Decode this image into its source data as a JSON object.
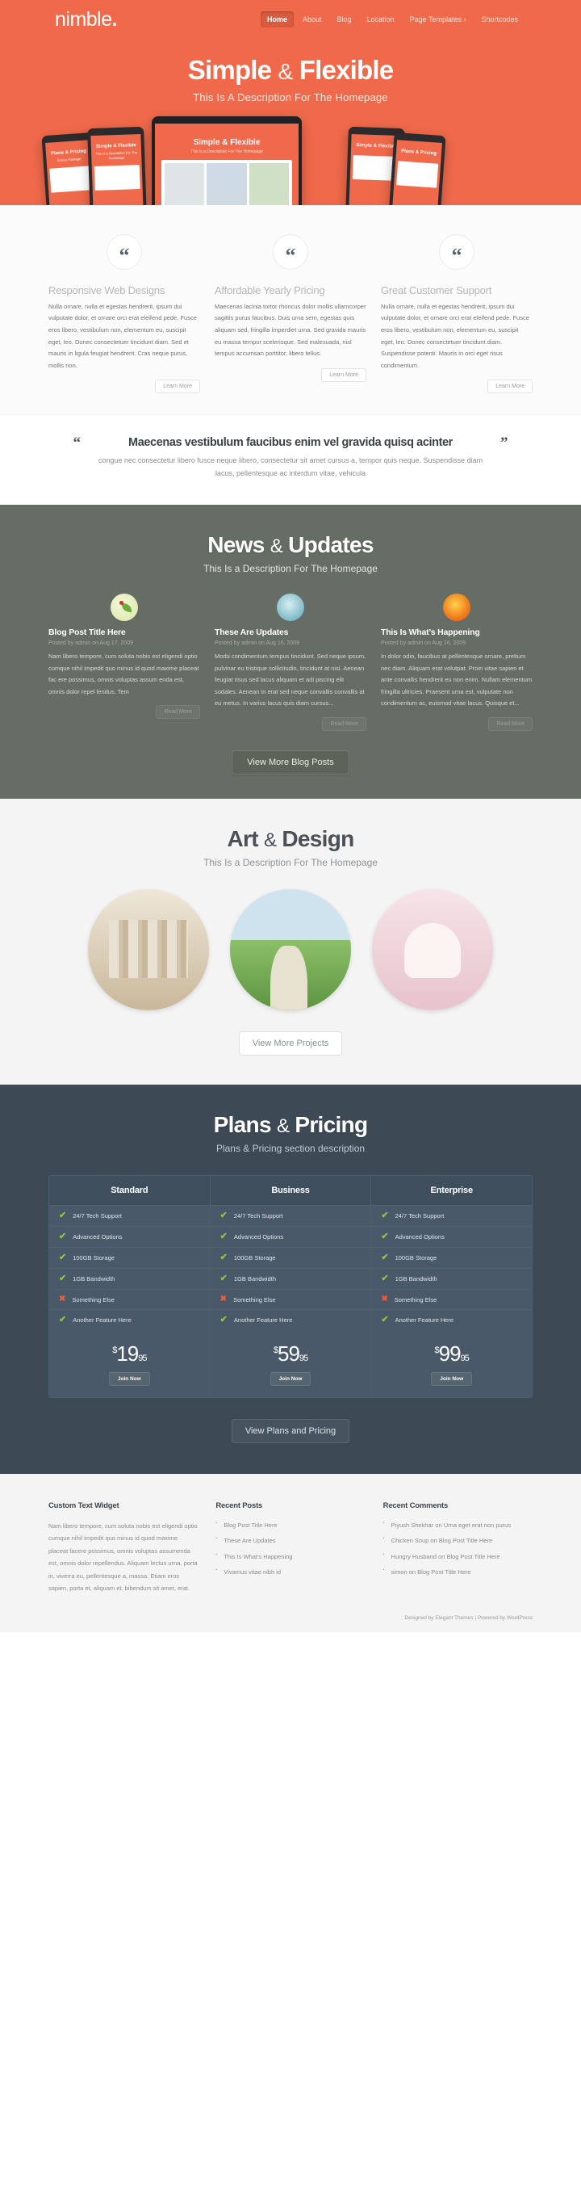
{
  "header": {
    "logo": "nimble",
    "logo_dot": ".",
    "nav": [
      {
        "label": "Home",
        "active": true
      },
      {
        "label": "About",
        "active": false
      },
      {
        "label": "Blog",
        "active": false
      },
      {
        "label": "Location",
        "active": false
      },
      {
        "label": "Page Templates ›",
        "active": false
      },
      {
        "label": "Shortcodes",
        "active": false
      }
    ]
  },
  "hero": {
    "title_main": "Simple",
    "title_amp": "&",
    "title_second": "Flexible",
    "subtitle": "This Is A Description For The Homepage",
    "device_title": "Simple & Flexible",
    "device_sub": "This Is a Description For The Homepage",
    "phone_title": "Plans & Pricing",
    "phone_sub": "Bronze Package"
  },
  "features": {
    "icon": "quote-icon",
    "button_label": "Learn More",
    "items": [
      {
        "title": "Responsive Web Designs",
        "body": "Nulla ornare, nulla et egestas hendrerit, ipsum dui vulputate dolor, et ornare orci erat eleifend pede. Fusce eros libero, vestibulum non, elementum eu, suscipit eget, leo. Donec consectetuer tincidunt diam. Sed et mauris in ligula feugiat hendrerit. Cras neque purus, mollis non."
      },
      {
        "title": "Affordable Yearly Pricing",
        "body": "Maecenas lacinia tortor rhoncus dolor mollis ullamcorper sagittis purus faucibus. Duis urna sem, egestas quis aliquam sed, fringilla imperdiet urna. Sed gravida mauris eu massa tempor scelerisque. Sed malesuada, nisl tempus accumsan porttitor, libero tellus."
      },
      {
        "title": "Great Customer Support",
        "body": "Nulla ornare, nulla et egestas hendrerit, ipsum dui vulputate dolor, et ornare orci erat eleifend pede. Fusce eros libero, vestibulum non, elementum eu, suscipit eget, leo. Donec consectetuer tincidunt diam. Suspendisse potenti. Mauris in orci eget risus condimentum."
      }
    ]
  },
  "quote": {
    "open_mark": "“",
    "close_mark": "”",
    "headline": "Maecenas vestibulum faucibus enim vel gravida quisq acinter",
    "body": "congue nec consectetur libero fusce neque libero, consectetur sit amet cursus a, tempor quis neque. Suspendisse diam lacus, pellentesque ac interdum vitae, vehicula"
  },
  "news": {
    "title_main": "News",
    "title_amp": "&",
    "title_second": "Updates",
    "subtitle": "This Is a Description For The Homepage",
    "read_more": "Read More",
    "cta": "View More Blog Posts",
    "posts": [
      {
        "icon": "leaf-ladybug-icon",
        "title": "Blog Post Title Here",
        "meta": "Posted by admin on Aug 17, 2009",
        "body": "Nam libero tempore, cum soluta nobis est eligendi optio cumque nihil impedit quo minus id quod maxime placeat fac ere possimus, omnis voluptas assum enda est, omnis dolor repel lendus. Tem"
      },
      {
        "icon": "water-drop-icon",
        "title": "These Are Updates",
        "meta": "Posted by admin on Aug 16, 2009",
        "body": "Morbi condimentum tempus tincidunt. Sed neque ipsum, pulvinar eu tristique sollicitudin, tincidunt at nisl. Aenean feugiat risus sed lacus aliquam et adi piscing elit sodales. Aenean in erat sed neque convallis convallis at eu metus. In varius lacus quis diam cursus..."
      },
      {
        "icon": "flower-icon",
        "title": "This Is What’s Happening",
        "meta": "Posted by admin on Aug 16, 2009",
        "body": "In dolor odio, faucibus at pellentesque ornare, pretium nec diam. Aliquam erat volutpat. Proin vitae sapien et ante convallis hendrerit eu non enim. Nullam elementum fringilla ultricies. Praesent urna est, vulputate non condimentum ac, euismod vitae lacus. Quisque et..."
      }
    ]
  },
  "art": {
    "title_main": "Art",
    "title_amp": "&",
    "title_second": "Design",
    "subtitle": "This Is a Description For The Homepage",
    "cta": "View More Projects",
    "projects": [
      {
        "name": "project-books"
      },
      {
        "name": "project-landscape"
      },
      {
        "name": "project-dolls"
      }
    ]
  },
  "pricing": {
    "title_main": "Plans",
    "title_amp": "&",
    "title_second": "Pricing",
    "subtitle": "Plans & Pricing section description",
    "join_label": "Join Now",
    "cta": "View Plans and Pricing",
    "features": [
      {
        "label": "24/7 Tech Support",
        "included": true
      },
      {
        "label": "Advanced Options",
        "included": true
      },
      {
        "label": "100GB Storage",
        "included": true
      },
      {
        "label": "1GB Bandwidth",
        "included": true
      },
      {
        "label": "Something Else",
        "included": false
      },
      {
        "label": "Another Feature Here",
        "included": true
      }
    ],
    "plans": [
      {
        "name": "Standard",
        "currency": "$",
        "amount": "19",
        "cents": "95"
      },
      {
        "name": "Business",
        "currency": "$",
        "amount": "59",
        "cents": "95"
      },
      {
        "name": "Enterprise",
        "currency": "$",
        "amount": "99",
        "cents": "95"
      }
    ]
  },
  "footer": {
    "custom_text": {
      "title": "Custom Text Widget",
      "body": "Nam libero tempore, cum soluta nobis est eligendi optio cumque nihil impedit quo minus id quod maxime placeat facere possimus, omnis voluptas assumenda est, omnis dolor repellendus. Aliquam lectus urna, porta in, viverra eu, pellentesque a, massa. Etiam eros sapien, porta et, aliquam et, bibendum sit amet, erat."
    },
    "recent_posts": {
      "title": "Recent Posts",
      "items": [
        "Blog Post Title Here",
        "These Are Updates",
        "This Is What's Happening",
        "Vivamus vitae nibh id"
      ]
    },
    "recent_comments": {
      "title": "Recent Comments",
      "items": [
        "Piyush Shekhar on Urna eget erat non purus",
        "Chicken Soup on Blog Post Title Here",
        "Hungry Husband on Blog Post Title Here",
        "simon on Blog Post Title Here"
      ]
    },
    "credit": "Designed by Elegant Themes | Powered by WordPress"
  },
  "colors": {
    "brand_orange": "#f0694a",
    "news_green": "#666d64",
    "pricing_navy": "#3d4a56",
    "tick_green": "#8dc63f",
    "cross_red": "#ef5b3c"
  }
}
